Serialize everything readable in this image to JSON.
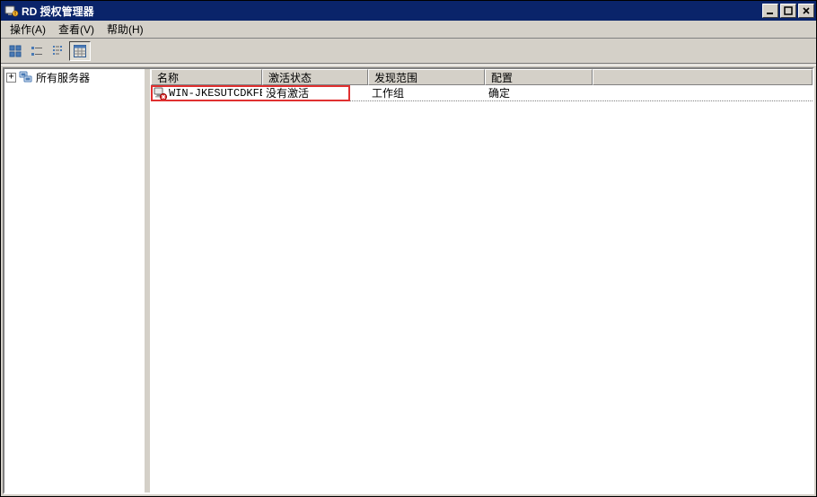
{
  "window": {
    "title": "RD 授权管理器"
  },
  "menu": {
    "action": "操作(A)",
    "view": "查看(V)",
    "help": "帮助(H)"
  },
  "tree": {
    "root": "所有服务器"
  },
  "columns": {
    "name": "名称",
    "activation": "激活状态",
    "scope": "发现范围",
    "config": "配置"
  },
  "rows": [
    {
      "name": "WIN-JKESUTCDKFE",
      "activation": "没有激活",
      "scope": "工作组",
      "config": "确定"
    }
  ],
  "icons": {
    "app": "rd-license-icon",
    "servers": "servers-icon",
    "server": "server-icon"
  }
}
